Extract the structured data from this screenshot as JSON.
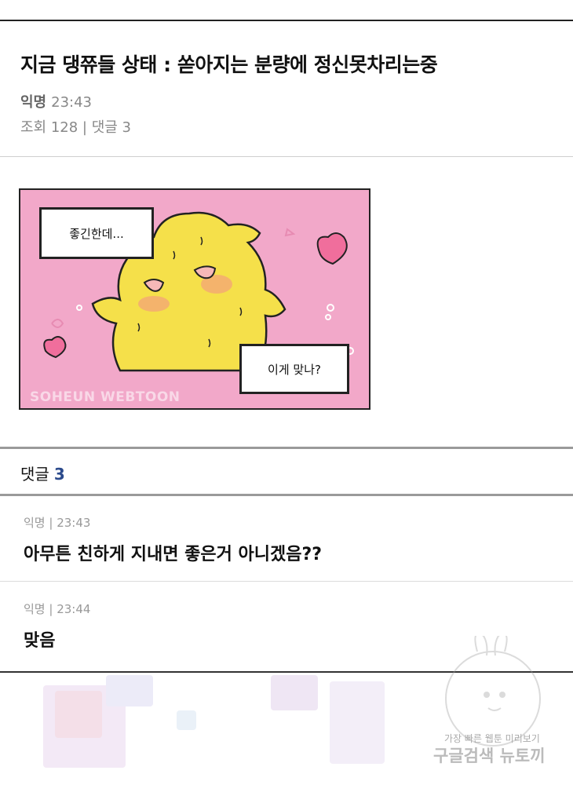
{
  "post": {
    "title": "지금 댕쮸들 상태 : 쏟아지는 분량에 정신못차리는중",
    "author": "익명",
    "time": "23:43",
    "stats": "조회 128 | 댓글 3"
  },
  "comic": {
    "bubble_top": "좋긴한데...",
    "bubble_bottom": "이게 맞나?",
    "watermark": "SOHEUN WEBTOON",
    "colors": {
      "background": "#f2a8c9",
      "character": "#f5e04a",
      "heart": "#f06e9c"
    }
  },
  "comments": {
    "label": "댓글",
    "count": "3",
    "items": [
      {
        "meta": "익명 | 23:43",
        "text": "아무튼 친하게 지내면 좋은거 아니겠음??"
      },
      {
        "meta": "익명 | 23:44",
        "text": "맞음"
      }
    ]
  },
  "site_watermark": {
    "line1": "가장 빠른 웹툰 미리보기",
    "line2": "구글검색 뉴토끼"
  }
}
